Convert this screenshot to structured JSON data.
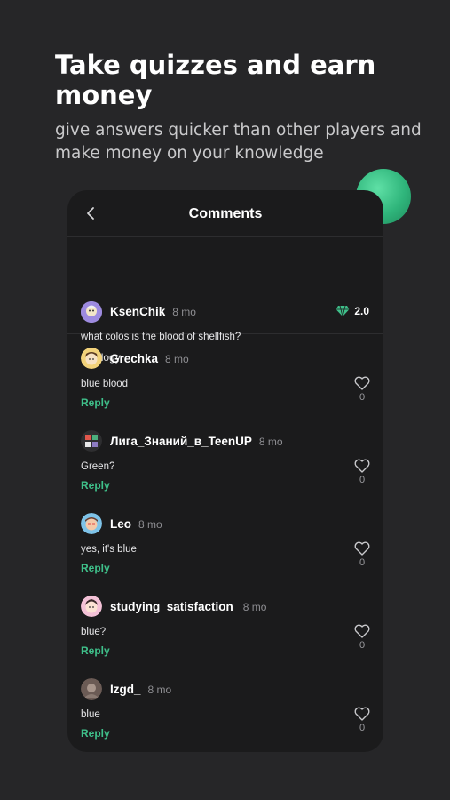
{
  "promo": {
    "headline": "Take quizzes and earn money",
    "subline": "give answers quicker than other players and make money on your knowledge"
  },
  "screen": {
    "title": "Comments",
    "post": {
      "username": "KsenChik",
      "time": "8 mo",
      "reward": "2.0",
      "text": "what colos is the blood of shellfish?",
      "tag": "#biology"
    },
    "reply_label": "Reply",
    "comments": [
      {
        "username": "Grechka",
        "time": "8 mo",
        "text": "blue blood",
        "likes": "0"
      },
      {
        "username": "Лига_Знаний_в_TeenUP",
        "time": "8 mo",
        "text": "Green?",
        "likes": "0"
      },
      {
        "username": "Leo",
        "time": "8 mo",
        "text": "yes, it's blue",
        "likes": "0"
      },
      {
        "username": "studying_satisfaction",
        "time": "8 mo",
        "text": "blue?",
        "likes": "0"
      },
      {
        "username": "Izgd_",
        "time": "8 mo",
        "text": "blue",
        "likes": "0"
      }
    ]
  },
  "colors": {
    "background": "#262628",
    "card": "#1b1b1c",
    "accent_green": "#3fc08a"
  },
  "icons": {
    "back": "chevron-left-icon",
    "reward": "diamond-icon",
    "like": "heart-icon"
  }
}
